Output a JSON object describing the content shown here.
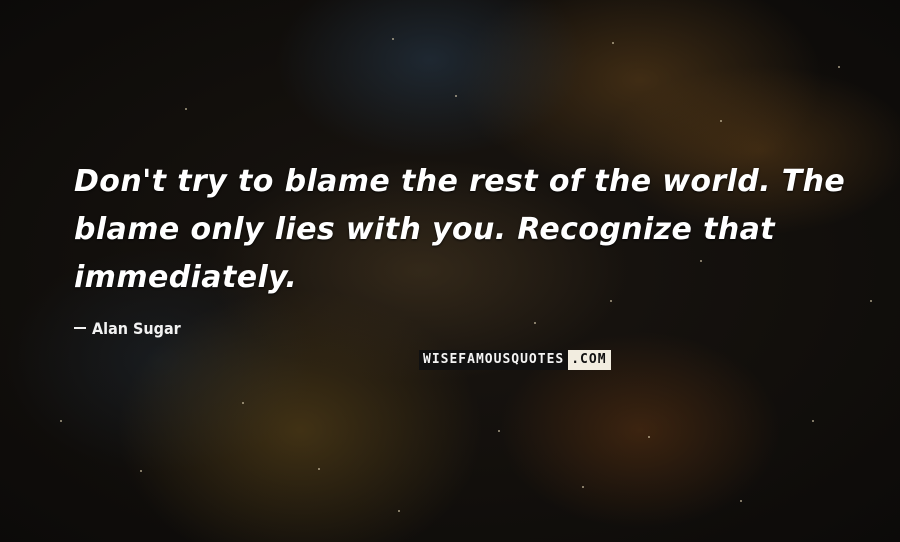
{
  "quote": {
    "line1": "Don't try to blame the rest of the world. The",
    "line2": "blame only lies with you. Recognize that",
    "line3": "immediately."
  },
  "author": "Alan Sugar",
  "watermark": {
    "left": "WISEFAMOUSQUOTES",
    "right": ".COM"
  },
  "colors": {
    "text": "#ffffff",
    "watermark_dark": "#111111",
    "watermark_light": "#f2ede0"
  }
}
